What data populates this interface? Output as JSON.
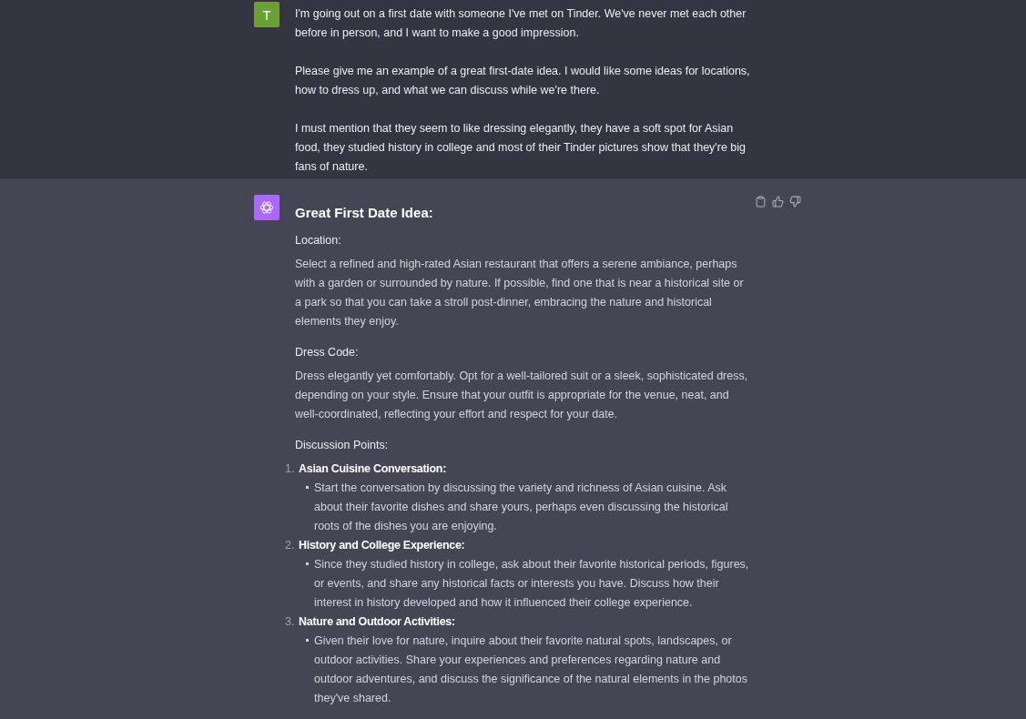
{
  "user_message": {
    "avatar_letter": "T",
    "paragraphs": [
      "I'm going out on a first date with someone I've met on Tinder. We've never met each other before in person, and I want to make a good impression.",
      "Please give me an example of a great first-date idea. I would like some ideas for locations, how to dress up, and what we can discuss while we're there.",
      "I must mention that they seem to like dressing elegantly, they have a soft spot for Asian food, they studied history in college and most of their Tinder pictures show that they're big fans of nature."
    ]
  },
  "assistant_message": {
    "title": "Great First Date Idea:",
    "sections": [
      {
        "heading": "Location:",
        "body": "Select a refined and high-rated Asian restaurant that offers a serene ambiance, perhaps with a garden or surrounded by nature. If possible, find one that is near a historical site or a park so that you can take a stroll post-dinner, embracing the nature and historical elements they enjoy."
      },
      {
        "heading": "Dress Code:",
        "body": "Dress elegantly yet comfortably. Opt for a well-tailored suit or a sleek, sophisticated dress, depending on your style. Ensure that your outfit is appropriate for the venue, neat, and well-coordinated, reflecting your effort and respect for your date."
      }
    ],
    "list_heading": "Discussion Points:",
    "discussion_points": [
      {
        "number": "1.",
        "title": "Asian Cuisine Conversation:",
        "bullets": [
          "Start the conversation by discussing the variety and richness of Asian cuisine. Ask about their favorite dishes and share yours, perhaps even discussing the historical roots of the dishes you are enjoying."
        ]
      },
      {
        "number": "2.",
        "title": "History and College Experience:",
        "bullets": [
          "Since they studied history in college, ask about their favorite historical periods, figures, or events, and share any historical facts or interests you have. Discuss how their interest in history developed and how it influenced their college experience."
        ]
      },
      {
        "number": "3.",
        "title": "Nature and Outdoor Activities:",
        "bullets": [
          "Given their love for nature, inquire about their favorite natural spots, landscapes, or outdoor activities. Share your experiences and preferences regarding nature and outdoor adventures, and discuss the significance of the natural elements in the photos they've shared."
        ]
      }
    ]
  }
}
